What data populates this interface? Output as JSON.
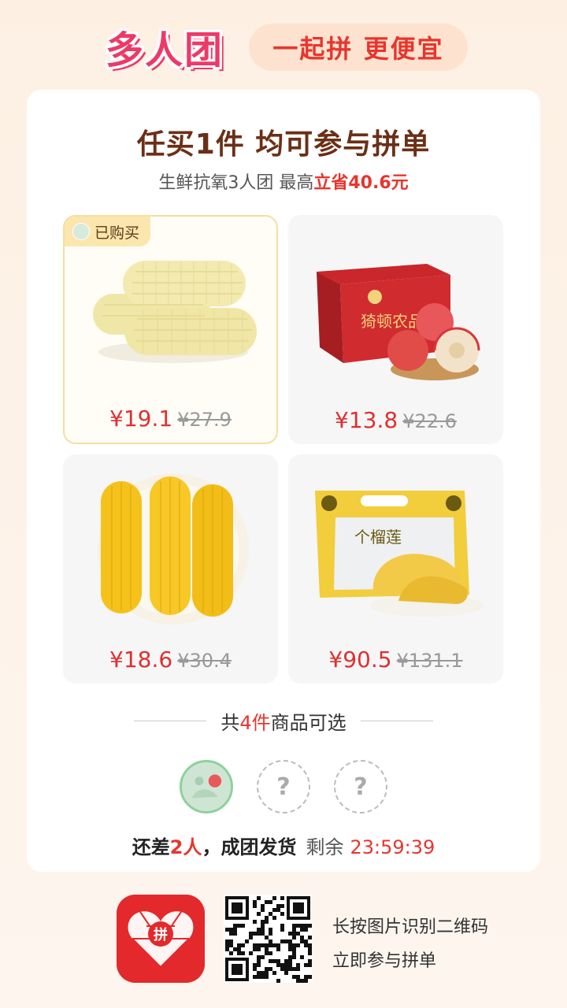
{
  "header": {
    "brand": "多人团",
    "slogan": "一起拼 更便宜"
  },
  "card": {
    "headline": "任买1件 均可参与拼单",
    "subline_prefix": "生鲜抗氧3人团 最高",
    "subline_highlight": "立省40.6元"
  },
  "products": [
    {
      "name": "white-corn",
      "price": "¥19.1",
      "original_price": "¥27.9",
      "bought": true
    },
    {
      "name": "apple-box",
      "price": "¥13.8",
      "original_price": "¥22.6",
      "bought": false,
      "box_text": "猗顿农品"
    },
    {
      "name": "yellow-corn",
      "price": "¥18.6",
      "original_price": "¥30.4",
      "bought": false
    },
    {
      "name": "durian-bag",
      "price": "¥90.5",
      "original_price": "¥131.1",
      "bought": false,
      "bag_text": "个榴莲"
    }
  ],
  "bought_tag": "已购买",
  "selection": {
    "prefix": "共",
    "count": "4件",
    "suffix": "商品可选"
  },
  "group_slots": {
    "empty_mark": "?"
  },
  "status": {
    "lack_prefix": "还差",
    "lack_count": "2人",
    "lack_suffix": "，成团发货",
    "remaining_label": "剩余",
    "countdown": "23:59:39"
  },
  "footer": {
    "app_icon_text": "拼",
    "line1": "长按图片识别二维码",
    "line2": "立即参与拼单"
  },
  "colors": {
    "accent_red": "#e8352d",
    "brand_pink": "#ec3a68",
    "headline_brown": "#6b2f16"
  }
}
